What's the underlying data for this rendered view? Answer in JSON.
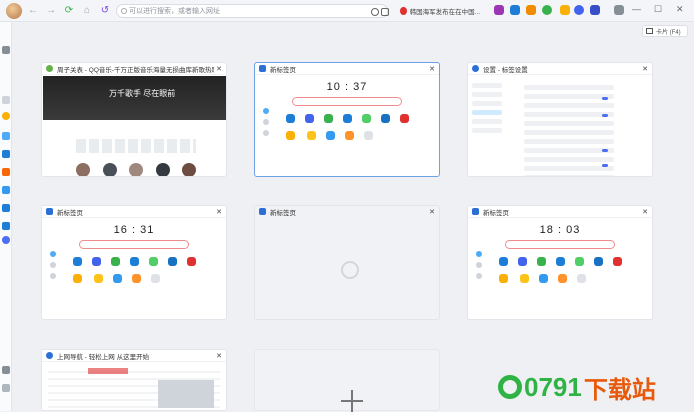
{
  "toolbar": {
    "back": "←",
    "forward": "→",
    "refresh": "⟳",
    "home": "⌂",
    "history": "↺",
    "address_placeholder": "可以进行搜索，或者输入网址",
    "hot_text": "韩国海军发布在在中国...",
    "view_label": "卡片 (F4)"
  },
  "window": {
    "minimize": "—",
    "maximize": "☐",
    "close": "✕"
  },
  "tabs": [
    {
      "title": "周子关表 - QQ音乐-千万正版音乐海量无损曲库新歌热歌天天...",
      "favicon_color": "#62b14a",
      "kind": "qq",
      "hero": "万千歌手 尽在眼前"
    },
    {
      "title": "新标签页",
      "favicon_color": "#2c6fd6",
      "kind": "ntp",
      "clock": "10 : 37",
      "active": true
    },
    {
      "title": "设置 - 标签设置",
      "favicon_color": "#2c6fd6",
      "kind": "settings"
    },
    {
      "title": "新标签页",
      "favicon_color": "#2c6fd6",
      "kind": "ntp",
      "clock": "16 : 31"
    },
    {
      "title": "新标签页",
      "favicon_color": "#2c6fd6",
      "kind": "blank"
    },
    {
      "title": "新标签页",
      "favicon_color": "#2c6fd6",
      "kind": "ntp",
      "clock": "18 : 03"
    },
    {
      "title": "上网导航 - 轻松上网 从这里开始",
      "favicon_color": "#2c6fd6",
      "kind": "nav"
    }
  ],
  "watermark": {
    "number": "0791",
    "text": "下载站"
  },
  "colors": {
    "accent": "#2c6fd6",
    "brand_green": "#2fb344",
    "brand_orange": "#e8590c"
  }
}
